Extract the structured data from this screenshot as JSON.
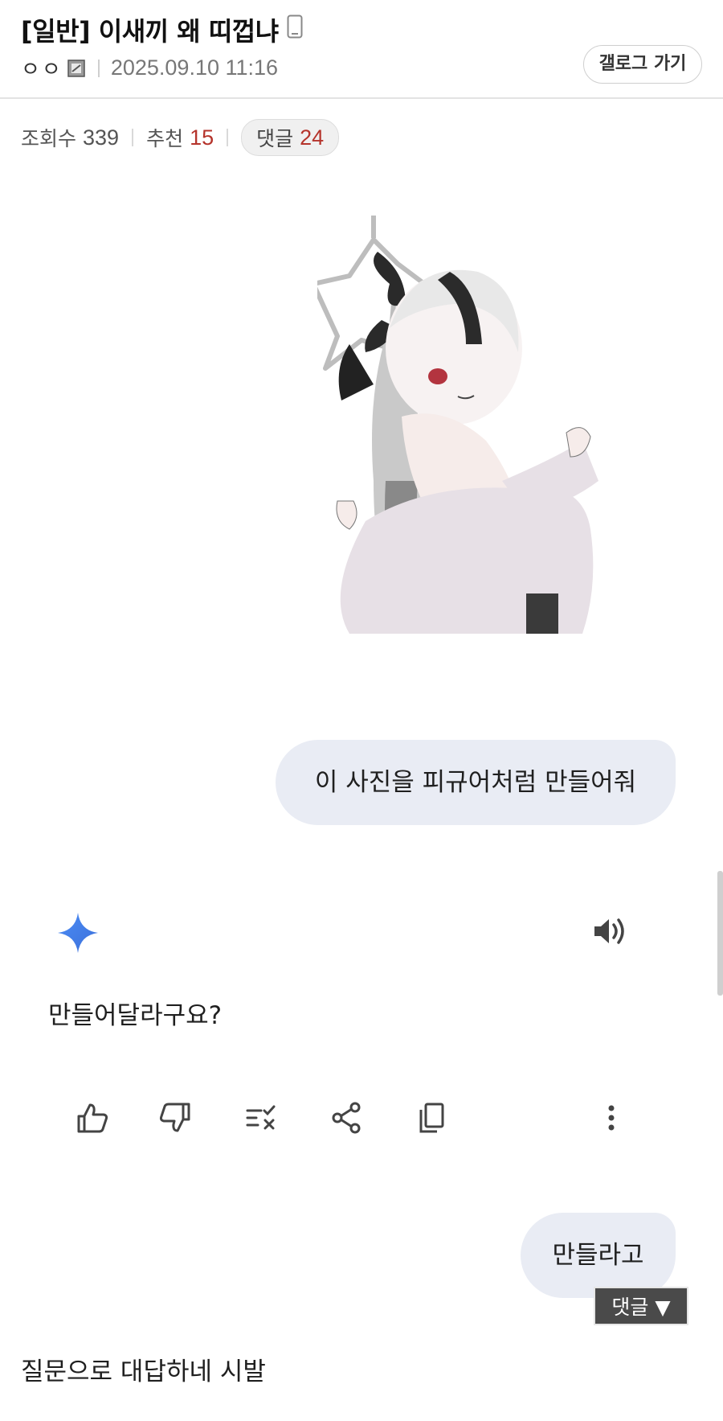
{
  "post": {
    "title": "[일반] 이새끼 왜 띠껍냐",
    "author": "ㅇㅇ",
    "datetime": "2025.09.10 11:16",
    "gallog_button": "갤로그 가기",
    "views_label": "조회수",
    "views": "339",
    "recommend_label": "추천",
    "recommend": "15",
    "comments_label": "댓글",
    "comments": "24",
    "body_text": "질문으로 대답하네 시발"
  },
  "chat": {
    "user_message_1": "이 사진을 피규어처럼 만들어줘",
    "ai_reply": "만들어달라구요?",
    "user_message_2": "만들라고"
  },
  "actions": [
    "thumbs-up",
    "thumbs-down",
    "double-check",
    "share",
    "copy",
    "more"
  ],
  "floating": {
    "comment_button": "댓글 ▼"
  },
  "colors": {
    "accent_red": "#b5342c",
    "bubble": "#e9ecf4",
    "gemini_blue": "#4285f4"
  }
}
